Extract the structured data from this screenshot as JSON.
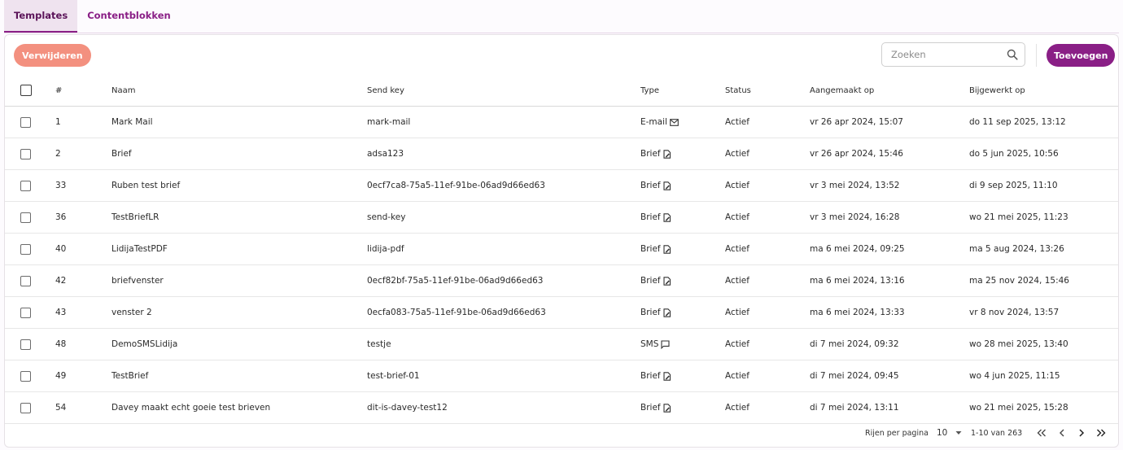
{
  "tabs": [
    {
      "label": "Templates",
      "active": true
    },
    {
      "label": "Contentblokken",
      "active": false
    }
  ],
  "toolbar": {
    "delete_label": "Verwijderen",
    "search_placeholder": "Zoeken",
    "add_label": "Toevoegen"
  },
  "columns": {
    "num": "#",
    "name": "Naam",
    "send_key": "Send key",
    "type": "Type",
    "status": "Status",
    "created": "Aangemaakt op",
    "updated": "Bijgewerkt op"
  },
  "rows": [
    {
      "num": "1",
      "name": "Mark Mail",
      "send_key": "mark-mail",
      "type": "E-mail",
      "type_icon": "mail-icon",
      "status": "Actief",
      "created": "vr 26 apr 2024, 15:07",
      "updated": "do 11 sep 2025, 13:12"
    },
    {
      "num": "2",
      "name": "Brief",
      "send_key": "adsa123",
      "type": "Brief",
      "type_icon": "document-edit-icon",
      "status": "Actief",
      "created": "vr 26 apr 2024, 15:46",
      "updated": "do 5 jun 2025, 10:56"
    },
    {
      "num": "33",
      "name": "Ruben test brief",
      "send_key": "0ecf7ca8-75a5-11ef-91be-06ad9d66ed63",
      "type": "Brief",
      "type_icon": "document-edit-icon",
      "status": "Actief",
      "created": "vr 3 mei 2024, 13:52",
      "updated": "di 9 sep 2025, 11:10"
    },
    {
      "num": "36",
      "name": "TestBriefLR",
      "send_key": "send-key",
      "type": "Brief",
      "type_icon": "document-edit-icon",
      "status": "Actief",
      "created": "vr 3 mei 2024, 16:28",
      "updated": "wo 21 mei 2025, 11:23"
    },
    {
      "num": "40",
      "name": "LidijaTestPDF",
      "send_key": "lidija-pdf",
      "type": "Brief",
      "type_icon": "document-edit-icon",
      "status": "Actief",
      "created": "ma 6 mei 2024, 09:25",
      "updated": "ma 5 aug 2024, 13:26"
    },
    {
      "num": "42",
      "name": "briefvenster",
      "send_key": "0ecf82bf-75a5-11ef-91be-06ad9d66ed63",
      "type": "Brief",
      "type_icon": "document-edit-icon",
      "status": "Actief",
      "created": "ma 6 mei 2024, 13:16",
      "updated": "ma 25 nov 2024, 15:46"
    },
    {
      "num": "43",
      "name": "venster 2",
      "send_key": "0ecfa083-75a5-11ef-91be-06ad9d66ed63",
      "type": "Brief",
      "type_icon": "document-edit-icon",
      "status": "Actief",
      "created": "ma 6 mei 2024, 13:33",
      "updated": "vr 8 nov 2024, 13:57"
    },
    {
      "num": "48",
      "name": "DemoSMSLidija",
      "send_key": "testje",
      "type": "SMS",
      "type_icon": "chat-bubble-icon",
      "status": "Actief",
      "created": "di 7 mei 2024, 09:32",
      "updated": "wo 28 mei 2025, 13:40"
    },
    {
      "num": "49",
      "name": "TestBrief",
      "send_key": "test-brief-01",
      "type": "Brief",
      "type_icon": "document-edit-icon",
      "status": "Actief",
      "created": "di 7 mei 2024, 09:45",
      "updated": "wo 4 jun 2025, 11:15"
    },
    {
      "num": "54",
      "name": "Davey maakt echt goeie test brieven",
      "send_key": "dit-is-davey-test12",
      "type": "Brief",
      "type_icon": "document-edit-icon",
      "status": "Actief",
      "created": "di 7 mei 2024, 13:11",
      "updated": "wo 21 mei 2025, 15:28"
    }
  ],
  "pagination": {
    "rows_per_page_label": "Rijen per pagina",
    "rows_per_page_value": "10",
    "range_text": "1-10 van 263"
  },
  "colors": {
    "primary": "#8a1f86",
    "delete_button": "#f3907f",
    "active_tab_bg": "#efe3ef"
  }
}
